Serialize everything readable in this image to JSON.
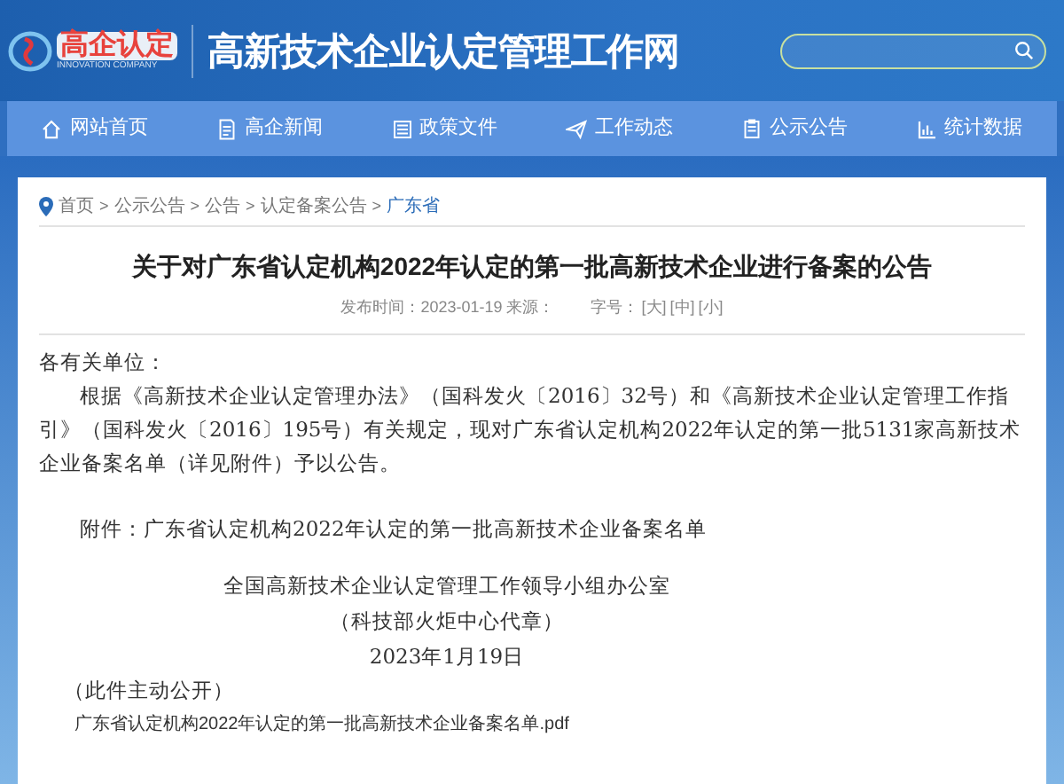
{
  "header": {
    "logo_text": "高企认定",
    "logo_subtitle": "INNOVATION COMPANY",
    "site_title": "高新技术企业认定管理工作网"
  },
  "nav": [
    {
      "label": "网站首页"
    },
    {
      "label": "高企新闻"
    },
    {
      "label": "政策文件"
    },
    {
      "label": "工作动态"
    },
    {
      "label": "公示公告"
    },
    {
      "label": "统计数据"
    }
  ],
  "breadcrumb": [
    {
      "label": "首页",
      "current": false
    },
    {
      "label": "公示公告",
      "current": false
    },
    {
      "label": "公告",
      "current": false
    },
    {
      "label": "认定备案公告",
      "current": false
    },
    {
      "label": "广东省",
      "current": true
    }
  ],
  "breadcrumb_separator": ">",
  "article": {
    "title": "关于对广东省认定机构2022年认定的第一批高新技术企业进行备案的公告",
    "meta": {
      "published": "发布时间：2023-01-19 来源：",
      "font_size_label": "字号：",
      "font_sizes": [
        "[大]",
        "[中]",
        "[小]"
      ]
    },
    "salutation": "各有关单位：",
    "body": "根据《高新技术企业认定管理办法》（国科发火〔2016〕32号）和《高新技术企业认定管理工作指引》（国科发火〔2016〕195号）有关规定，现对广东省认定机构2022年认定的第一批5131家高新技术企业备案名单（详见附件）予以公告。",
    "attachment_line": "附件：广东省认定机构2022年认定的第一批高新技术企业备案名单",
    "signature": [
      "全国高新技术企业认定管理工作领导小组办公室",
      "（科技部火炬中心代章）",
      "2023年1月19日"
    ],
    "note": "（此件主动公开）",
    "file_link": "广东省认定机构2022年认定的第一批高新技术企业备案名单.pdf"
  }
}
